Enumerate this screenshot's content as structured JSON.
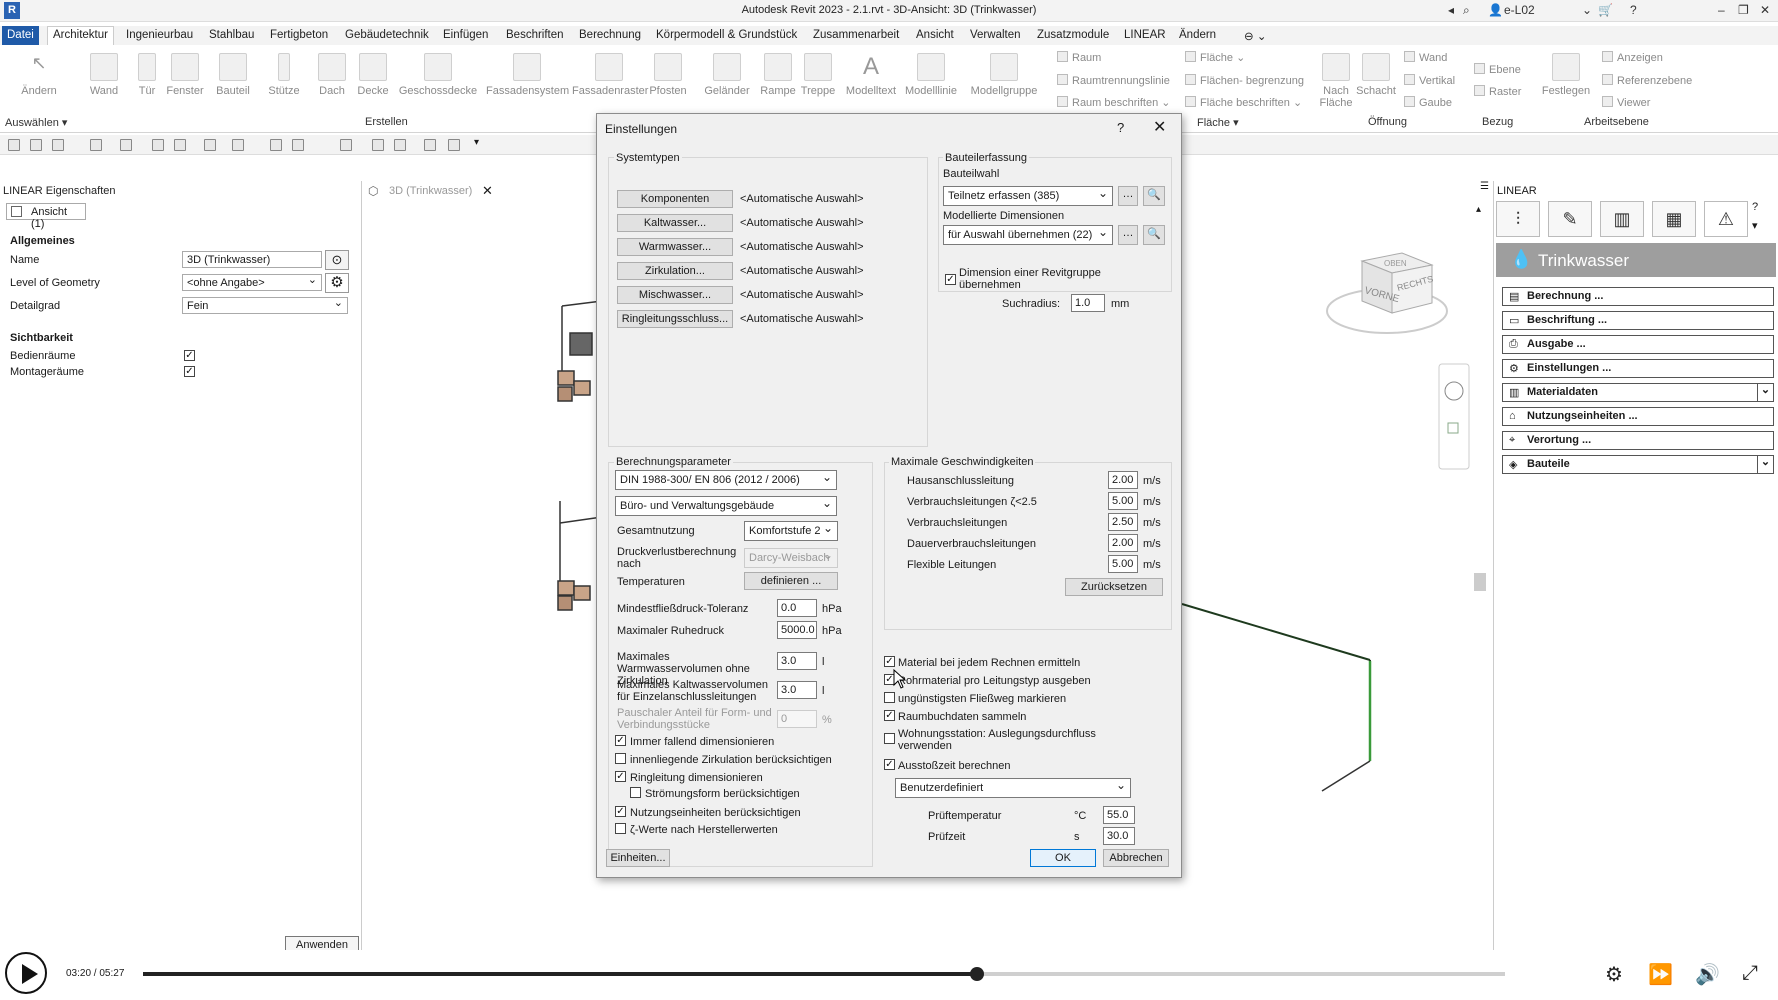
{
  "window": {
    "title": "Autodesk Revit 2023 - 2.1.rvt - 3D-Ansicht: 3D (Trinkwasser)",
    "user": "e-L02"
  },
  "tabs": [
    "Datei",
    "Architektur",
    "Ingenieurbau",
    "Stahlbau",
    "Fertigbeton",
    "Gebäudetechnik",
    "Einfügen",
    "Beschriften",
    "Berechnung",
    "Körpermodell & Grundstück",
    "Zusammenarbeit",
    "Ansicht",
    "Verwalten",
    "Zusatzmodule",
    "LINEAR",
    "Ändern"
  ],
  "ribbon": {
    "buttons": [
      "Ändern",
      "Wand",
      "Tür",
      "Fenster",
      "Bauteil",
      "Stütze",
      "Dach",
      "Decke",
      "Geschossdecke",
      "Fassadensystem",
      "Fassadenraster",
      "Pfosten",
      "Geländer",
      "Rampe",
      "Treppe",
      "Modelltext",
      "Modelllinie",
      "Modellgruppe"
    ],
    "small": [
      "Raum",
      "Raumtrennungslinie",
      "Raum beschriften",
      "Fläche",
      "Flächen- begrenzung",
      "Fläche beschriften",
      "Nach Fläche",
      "Schacht",
      "Wand",
      "Vertikal",
      "Gaube",
      "Ebene",
      "Raster",
      "Festlegen",
      "Anzeigen",
      "Referenzebene",
      "Viewer"
    ],
    "groups": [
      "Auswählen",
      "Erstellen",
      "Fläche",
      "Öffnung",
      "Bezug",
      "Arbeitsebene"
    ]
  },
  "left_panel": {
    "title": "LINEAR Eigenschaften",
    "selector": "Ansicht (1)",
    "section_general": "Allgemeines",
    "name_label": "Name",
    "name_value": "3D (Trinkwasser)",
    "log_label": "Level of Geometry",
    "log_value": "<ohne Angabe>",
    "detail_label": "Detailgrad",
    "detail_value": "Fein",
    "section_visibility": "Sichtbarkeit",
    "bedienraeume": "Bedienräume",
    "montageraeume": "Montageräume",
    "apply": "Anwenden"
  },
  "view_tab": "3D (Trinkwasser)",
  "viewcube": {
    "top": "OBEN",
    "front": "VORNE",
    "right": "RECHTS"
  },
  "right_panel": {
    "title": "LINEAR",
    "banner": "Trinkwasser",
    "buttons": [
      "Berechnung ...",
      "Beschriftung ...",
      "Ausgabe ...",
      "Einstellungen ...",
      "Materialdaten",
      "Nutzungseinheiten ...",
      "Verortung ...",
      "Bauteile"
    ],
    "icons": [
      "settings-sliders",
      "pencil",
      "library",
      "grid",
      "warning"
    ]
  },
  "dialog": {
    "title": "Einstellungen",
    "help": "?",
    "systemtypen": {
      "title": "Systemtypen",
      "rows": [
        {
          "button": "Komponenten",
          "value": "<Automatische Auswahl>"
        },
        {
          "button": "Kaltwasser...",
          "value": "<Automatische Auswahl>"
        },
        {
          "button": "Warmwasser...",
          "value": "<Automatische Auswahl>"
        },
        {
          "button": "Zirkulation...",
          "value": "<Automatische Auswahl>"
        },
        {
          "button": "Mischwasser...",
          "value": "<Automatische Auswahl>"
        },
        {
          "button": "Ringleitungsschluss...",
          "value": "<Automatische Auswahl>"
        }
      ]
    },
    "bauteilerfassung": {
      "title": "Bauteilerfassung",
      "bauteilwahl_label": "Bauteilwahl",
      "bauteilwahl_value": "Teilnetz erfassen (385)",
      "dimensionen_label": "Modellierte Dimensionen",
      "dimensionen_value": "für Auswahl übernehmen (22)",
      "revit_group_label": "Dimension einer Revitgruppe übernehmen",
      "suchradius_label": "Suchradius:",
      "suchradius_value": "1.0",
      "suchradius_unit": "mm"
    },
    "berechnung": {
      "title": "Berechnungsparameter",
      "norm": "DIN 1988-300/ EN 806 (2012 / 2006)",
      "gebaeude": "Büro- und Verwaltungsgebäude",
      "gesamtnutzung_label": "Gesamtnutzung",
      "gesamtnutzung_value": "Komfortstufe 2",
      "druckverlust_label": "Druckverlustberechnung nach",
      "druckverlust_value": "Darcy-Weisbach",
      "temperaturen_label": "Temperaturen",
      "temperaturen_button": "definieren ...",
      "mindestfliess_label": "Mindestfließdruck-Toleranz",
      "mindestfliess_value": "0.0",
      "ruhedruck_label": "Maximaler Ruhedruck",
      "ruhedruck_value": "5000.0",
      "hpa": "hPa",
      "warmwasser_label": "Maximales Warmwasservolumen ohne Zirkulation",
      "warmwasser_value": "3.0",
      "kaltwasser_label": "Maximales Kaltwasservolumen für Einzelanschlussleitungen",
      "kaltwasser_value": "3.0",
      "liter": "l",
      "pauschal_label": "Pauschaler Anteil für Form- und Verbindungsstücke",
      "pauschal_value": "0",
      "percent": "%",
      "checks": [
        {
          "label": "Immer fallend dimensionieren",
          "checked": "✓"
        },
        {
          "label": "innenliegende Zirkulation berücksichtigen",
          "checked": ""
        },
        {
          "label": "Ringleitung dimensionieren",
          "checked": "✓"
        },
        {
          "label": "Strömungsform berücksichtigen",
          "checked": ""
        },
        {
          "label": "Nutzungseinheiten berücksichtigen",
          "checked": "✓"
        },
        {
          "label": "ζ-Werte nach Herstellerwerten",
          "checked": ""
        }
      ]
    },
    "geschwindigkeiten": {
      "title": "Maximale Geschwindigkeiten",
      "unit": "m/s",
      "rows": [
        {
          "label": "Hausanschlussleitung",
          "value": "2.00"
        },
        {
          "label": "Verbrauchsleitungen ζ<2.5",
          "value": "5.00"
        },
        {
          "label": "Verbrauchsleitungen",
          "value": "2.50"
        },
        {
          "label": "Dauerverbrauchsleitungen",
          "value": "2.00"
        },
        {
          "label": "Flexible Leitungen",
          "value": "5.00"
        }
      ],
      "reset": "Zurücksetzen"
    },
    "options": [
      {
        "label": "Material bei jedem Rechnen ermitteln",
        "checked": "✓"
      },
      {
        "label": "Rohrmaterial pro Leitungstyp ausgeben",
        "checked": "✓"
      },
      {
        "label": "ungünstigsten Fließweg markieren",
        "checked": ""
      },
      {
        "label": "Raumbuchdaten sammeln",
        "checked": "✓"
      },
      {
        "label": "Wohnungsstation: Auslegungsdurchfluss verwenden",
        "checked": ""
      },
      {
        "label": "Ausstoßzeit berechnen",
        "checked": "✓"
      }
    ],
    "ausstoss": {
      "mode": "Benutzerdefiniert",
      "pruef_temp_label": "Prüftemperatur",
      "pruef_temp_unit": "°C",
      "pruef_temp_value": "55.0",
      "pruefzeit_label": "Prüfzeit",
      "pruefzeit_unit": "s",
      "pruefzeit_value": "30.0"
    },
    "einheiten": "Einheiten...",
    "ok": "OK",
    "cancel": "Abbrechen"
  },
  "player": {
    "time": "03:20 / 05:27",
    "progress": 0.612
  }
}
